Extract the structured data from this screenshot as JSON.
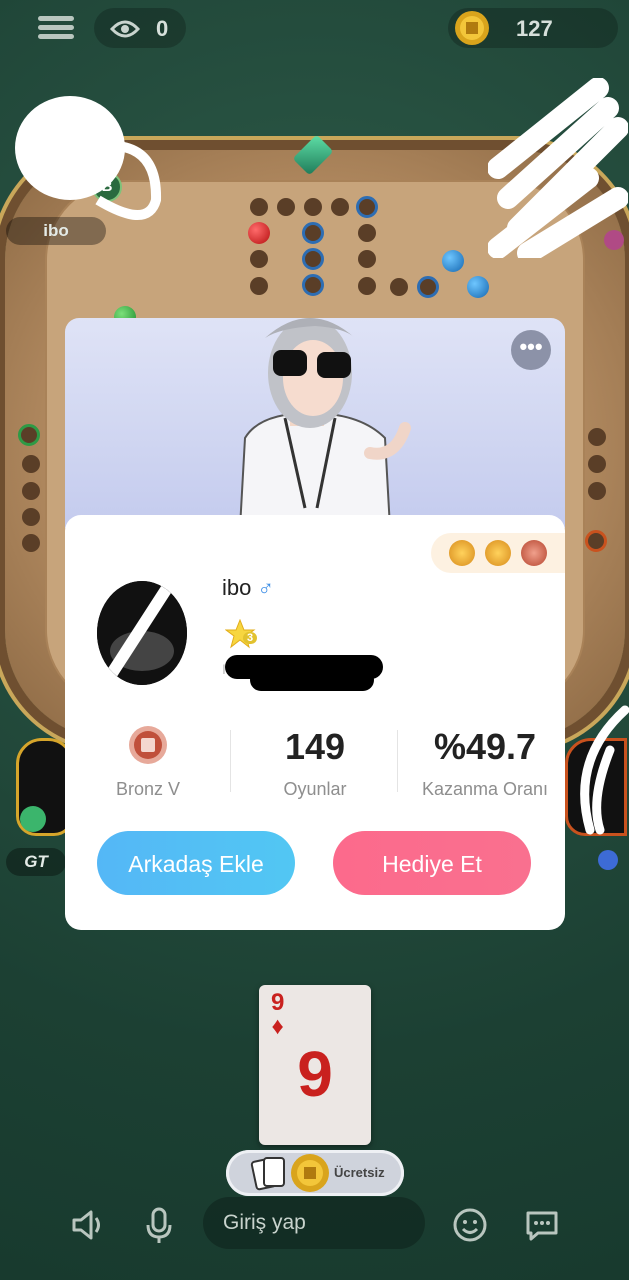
{
  "topbar": {
    "viewer_count": "0",
    "coin_count": "127"
  },
  "players": {
    "top_left_name": "ibo",
    "left_name_partial": "GT",
    "left_level_badge": "B"
  },
  "profile": {
    "username": "ibo",
    "gender_symbol": "♂",
    "level": "3",
    "id_label": "ID: ",
    "stats": [
      {
        "value": "",
        "label": "Bronz V"
      },
      {
        "value": "149",
        "label": "Oyunlar"
      },
      {
        "value": "%49.7",
        "label": "Kazanma Oranı"
      }
    ],
    "add_friend_label": "Arkadaş Ekle",
    "gift_label": "Hediye Et",
    "more_label": "•••"
  },
  "card": {
    "rank": "9",
    "suit": "♦"
  },
  "free_label": "Ücretsiz",
  "chat": {
    "input_placeholder": "Giriş yap"
  },
  "colors": {
    "add_friend": "#54b7f6",
    "gift": "#fc6a8c",
    "gender": "#3d8ee6",
    "card_red": "#c9211e"
  }
}
